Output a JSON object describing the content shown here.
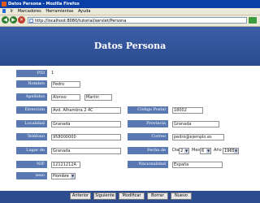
{
  "window": {
    "title": "Datos Persona - Mozilla Firefox"
  },
  "menu": {
    "items": [
      "Marcadores",
      "Herramientas",
      "Ayuda"
    ],
    "first": "Ir"
  },
  "address": {
    "url": "http://localhost:8080/tutorial/servlet/Persona"
  },
  "page": {
    "title": "Datos Persona"
  },
  "form": {
    "pid_label": "PID",
    "pid_value": "1",
    "nombre_label": "Nombre",
    "nombre_value": "Pedro",
    "apellidos_label": "Apellidos",
    "apellido1_value": "Alonso",
    "apellido2_value": "Martín",
    "direccion_label": "Dirección",
    "direccion_value": "Avd. Alhambra 2 4C",
    "codigo_postal_label": "Código Postal",
    "codigo_postal_value": "18002",
    "localidad_label": "Localidad",
    "localidad_value": "Granada",
    "provincia_label": "Provincia",
    "provincia_value": "Granada",
    "telefono_label": "Teléfono",
    "telefono_value": "958000000",
    "correo_label": "Correo Electrónico",
    "correo_value": "pedro@ejemplo.es",
    "lugar_nacimiento_label": "Lugar de Nacimiento",
    "lugar_nacimiento_value": "Granada",
    "fecha_nacimiento_label": "Fecha de Nacimiento",
    "dia_label": "Dia",
    "dia_value": "2",
    "mes_label": "Mes",
    "mes_value": "6",
    "anio_label": "Año",
    "anio_value": "1965",
    "nif_label": "NIF",
    "nif_value": "12121212A",
    "nacionalidad_label": "Nacionalidad",
    "nacionalidad_value": "España",
    "sexo_label": "sexo",
    "sexo_value": "Hombre"
  },
  "buttons": {
    "anterior": "Anterior",
    "siguiente": "Siguiente",
    "modificar": "Modificar",
    "borrar": "Borrar",
    "nuevo": "Nuevo"
  },
  "colors": {
    "label_bg": "#5a79b3",
    "banner_bg": "#3c5fa8",
    "bottom_bar": "#2d4c8f"
  }
}
